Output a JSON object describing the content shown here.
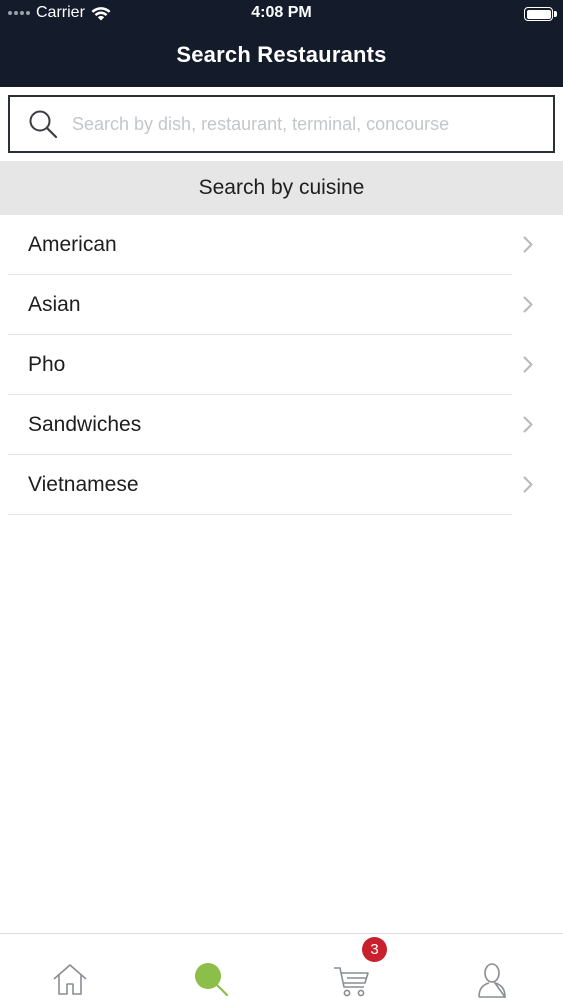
{
  "status_bar": {
    "carrier": "Carrier",
    "time": "4:08 PM"
  },
  "header": {
    "title": "Search Restaurants",
    "background_color": "#141b2a"
  },
  "search": {
    "placeholder": "Search by dish, restaurant, terminal, concourse",
    "value": ""
  },
  "cuisine_section": {
    "title": "Search by cuisine",
    "items": [
      {
        "label": "American"
      },
      {
        "label": "Asian"
      },
      {
        "label": "Pho"
      },
      {
        "label": "Sandwiches"
      },
      {
        "label": "Vietnamese"
      }
    ]
  },
  "tab_bar": {
    "tabs": [
      {
        "icon": "home-icon",
        "active": false
      },
      {
        "icon": "search-icon",
        "active": true,
        "active_color": "#8cbf4a"
      },
      {
        "icon": "cart-icon",
        "active": false,
        "badge": "3",
        "badge_color": "#c8202c"
      },
      {
        "icon": "profile-icon",
        "active": false
      }
    ]
  }
}
